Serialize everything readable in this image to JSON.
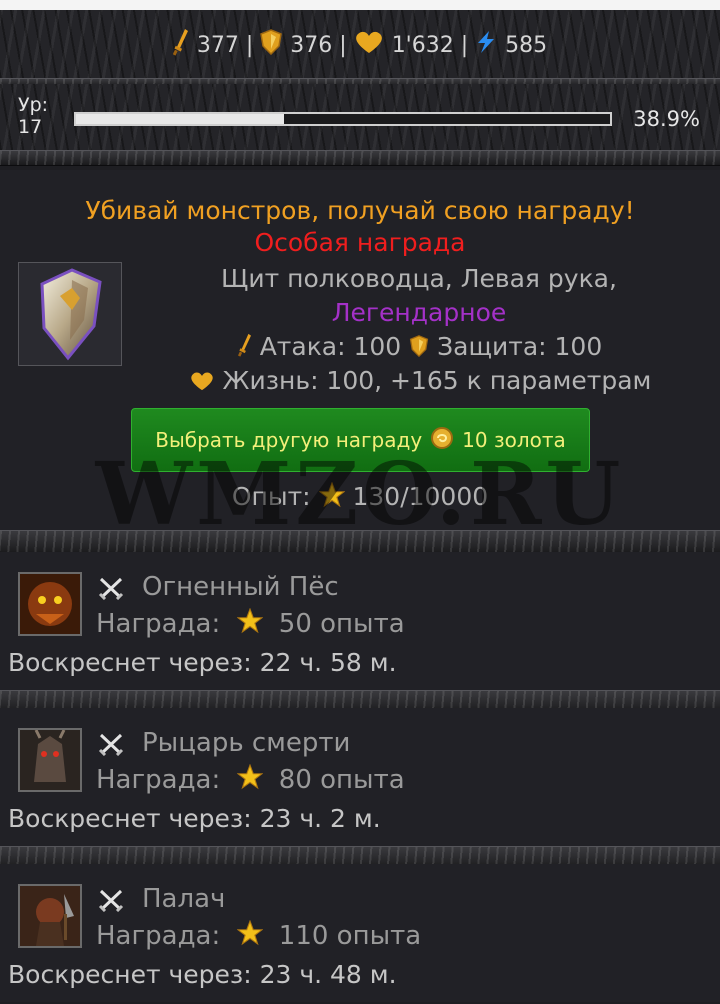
{
  "header": {
    "stats": [
      {
        "icon": "sword-icon",
        "value": "377"
      },
      {
        "icon": "shield-icon",
        "value": "376"
      },
      {
        "icon": "heart-icon",
        "value": "1'632"
      },
      {
        "icon": "lightning-icon",
        "value": "585"
      }
    ],
    "separator": "|"
  },
  "level": {
    "label_line1": "Ур:",
    "label_line2": "17",
    "progress_percent": 38.9,
    "progress_text": "38.9%"
  },
  "reward": {
    "title": "Убивай монстров, получай свою награду!",
    "special": "Особая награда",
    "item_name": "Щит полководца, Левая рука,",
    "rarity": "Легендарное",
    "attack_label": "Атака: 100",
    "defense_label": "Защита: 100",
    "life_label": "Жизнь: 100, +165 к параметрам",
    "reroll_button_text": "Выбрать другую награду",
    "reroll_cost": "10 золота",
    "xp_label": "Опыт:",
    "xp_value": "130/10000",
    "watermark": "WMZO.RU"
  },
  "monsters": [
    {
      "name": "Огненный Пёс",
      "reward_label": "Награда:",
      "reward_value": "50 опыта",
      "respawn": "Воскреснет через: 22 ч. 58 м.",
      "portrait": "fire-dog"
    },
    {
      "name": "Рыцарь смерти",
      "reward_label": "Награда:",
      "reward_value": "80 опыта",
      "respawn": "Воскреснет через: 23 ч. 2 м.",
      "portrait": "death-knight"
    },
    {
      "name": "Палач",
      "reward_label": "Награда:",
      "reward_value": "110 опыта",
      "respawn": "Воскреснет через: 23 ч. 48 м.",
      "portrait": "executioner"
    }
  ],
  "colors": {
    "reward_title": "#f0a022",
    "special": "#f01e1e",
    "legendary": "#a431c8",
    "button_green": "#1f8a1f",
    "button_text": "#f3ef7a"
  }
}
